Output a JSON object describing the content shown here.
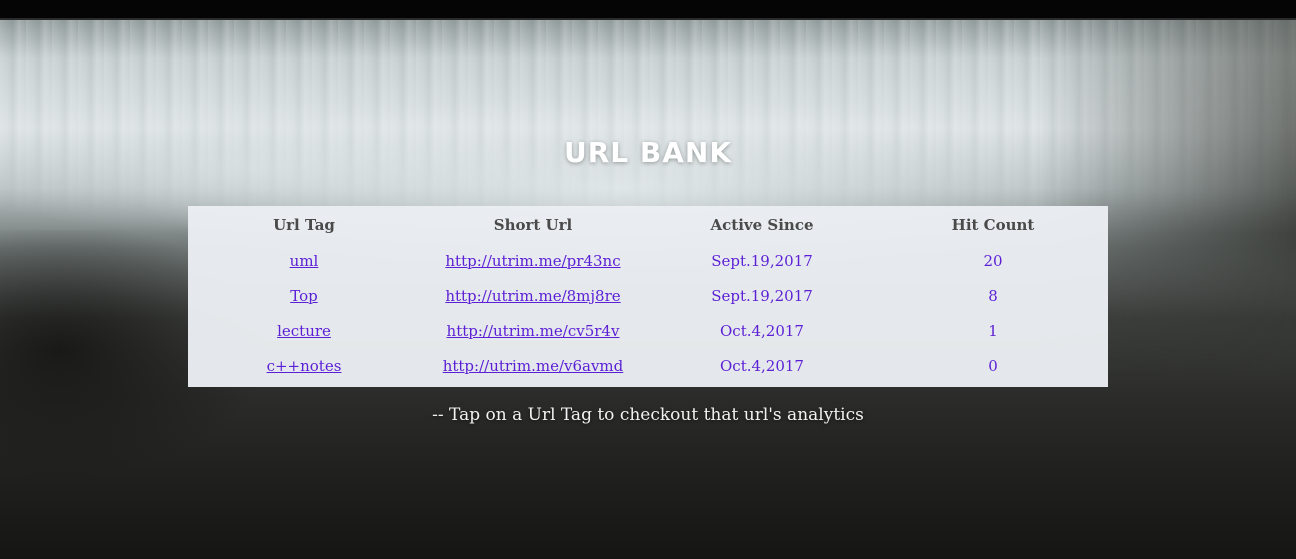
{
  "header": {
    "title": "URL BANK"
  },
  "table": {
    "columns": [
      "Url Tag",
      "Short Url",
      "Active Since",
      "Hit Count"
    ],
    "rows": [
      {
        "tag": "uml",
        "short_url": "http://utrim.me/pr43nc",
        "active_since": "Sept.19,2017",
        "hit_count": "20"
      },
      {
        "tag": "Top",
        "short_url": "http://utrim.me/8mj8re",
        "active_since": "Sept.19,2017",
        "hit_count": "8"
      },
      {
        "tag": "lecture",
        "short_url": "http://utrim.me/cv5r4v",
        "active_since": "Oct.4,2017",
        "hit_count": "1"
      },
      {
        "tag": "c++notes",
        "short_url": "http://utrim.me/v6avmd",
        "active_since": "Oct.4,2017",
        "hit_count": "0"
      }
    ]
  },
  "footer": {
    "hint": "-- Tap on a Url Tag to checkout that url's analytics"
  },
  "colors": {
    "link": "#5b1fd6",
    "table_bg": "#eaedf2",
    "title": "#ffffff"
  }
}
